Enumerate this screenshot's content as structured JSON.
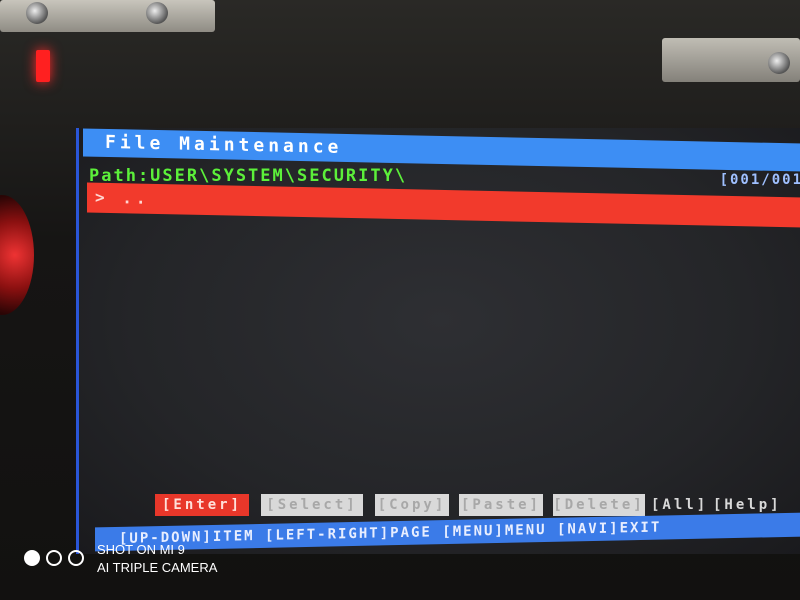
{
  "window": {
    "title": "File Maintenance",
    "page_counter": "[001/001"
  },
  "path": {
    "text": "Path:USER\\SYSTEM\\SECURITY\\"
  },
  "file_list": {
    "items": [
      {
        "label": "> ..",
        "selected": true
      }
    ]
  },
  "softkeys": [
    {
      "label": "[Enter]",
      "state": "active"
    },
    {
      "label": "[Select]",
      "state": "disabled"
    },
    {
      "label": "[Copy]",
      "state": "disabled"
    },
    {
      "label": "[Paste]",
      "state": "disabled"
    },
    {
      "label": "[Delete]",
      "state": "disabled"
    },
    {
      "label": "[All]",
      "state": "plain"
    },
    {
      "label": "[Help]",
      "state": "plain"
    }
  ],
  "help_bar": {
    "text": "[UP-DOWN]ITEM [LEFT-RIGHT]PAGE [MENU]MENU [NAVI]EXIT"
  },
  "watermark": {
    "line1": "SHOT ON MI 9",
    "line2": "AI TRIPLE CAMERA"
  },
  "colors": {
    "title_bar": "#3d8ef4",
    "path_text": "#5cf03a",
    "selection": "#f23a2c",
    "active_key": "#e8372a",
    "disabled_key": "#d9d9d9",
    "help_bar": "#3b7be8"
  }
}
